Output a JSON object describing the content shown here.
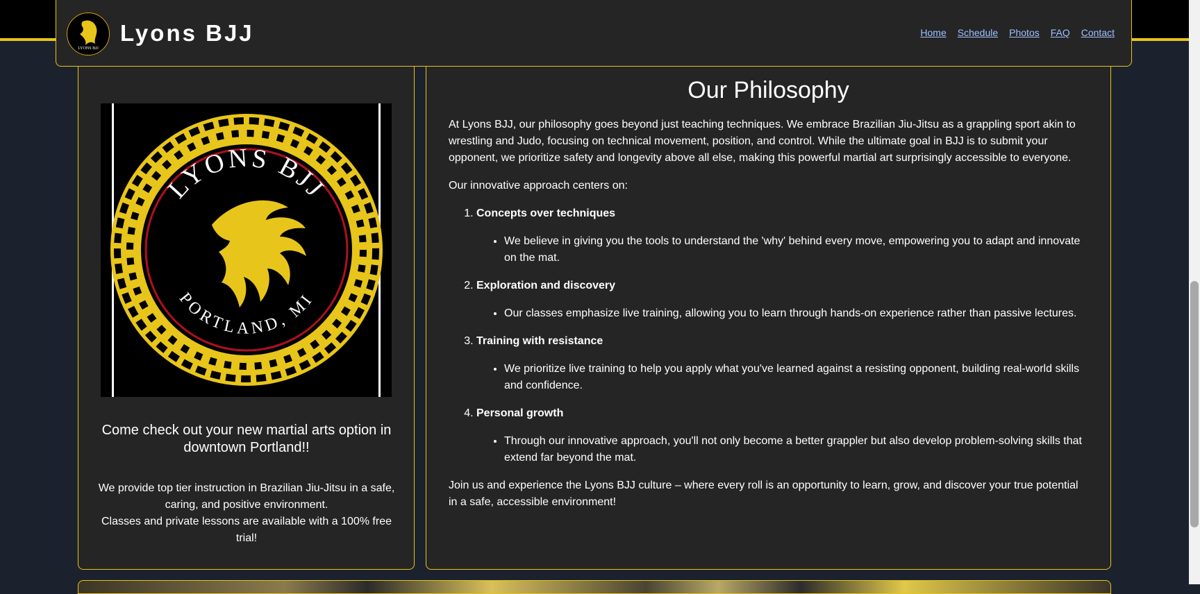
{
  "header": {
    "title": "Lyons BJJ",
    "logo_text": "LYONS BJJ",
    "nav": [
      "Home",
      "Schedule",
      "Photos",
      "FAQ",
      "Contact"
    ]
  },
  "left_card": {
    "logo_top_text": "LYONS BJJ",
    "logo_bottom_text": "PORTLAND, MI",
    "tagline": "Come check out your new martial arts option in downtown Portland!!",
    "desc_line1": "We provide top tier instruction in Brazilian Jiu-Jitsu in a safe, caring, and positive environment.",
    "desc_line2": "Classes and private lessons are available with a 100% free trial!"
  },
  "philosophy": {
    "title": "Our Philosophy",
    "intro": "At Lyons BJJ, our philosophy goes beyond just teaching techniques. We embrace Brazilian Jiu-Jitsu as a grappling sport akin to wrestling and Judo, focusing on technical movement, position, and control. While the ultimate goal in BJJ is to submit your opponent, we prioritize safety and longevity above all else, making this powerful martial art surprisingly accessible to everyone.",
    "approach_intro": "Our innovative approach centers on:",
    "items": [
      {
        "title": "Concepts over techniques",
        "detail": "We believe in giving you the tools to understand the 'why' behind every move, empowering you to adapt and innovate on the mat."
      },
      {
        "title": "Exploration and discovery",
        "detail": "Our classes emphasize live training, allowing you to learn through hands-on experience rather than passive lectures."
      },
      {
        "title": "Training with resistance",
        "detail": "We prioritize live training to help you apply what you've learned against a resisting opponent, building real-world skills and confidence."
      },
      {
        "title": "Personal growth",
        "detail": "Through our innovative approach, you'll not only become a better grappler but also develop problem-solving skills that extend far beyond the mat."
      }
    ],
    "closing": "Join us and experience the Lyons BJJ culture – where every roll is an opportunity to learn, grow, and discover your true potential in a safe, accessible environment!"
  },
  "colors": {
    "accent": "#e8c51a",
    "card_bg": "#252525",
    "page_bg": "#1c222d",
    "link": "#9ec1ff"
  }
}
